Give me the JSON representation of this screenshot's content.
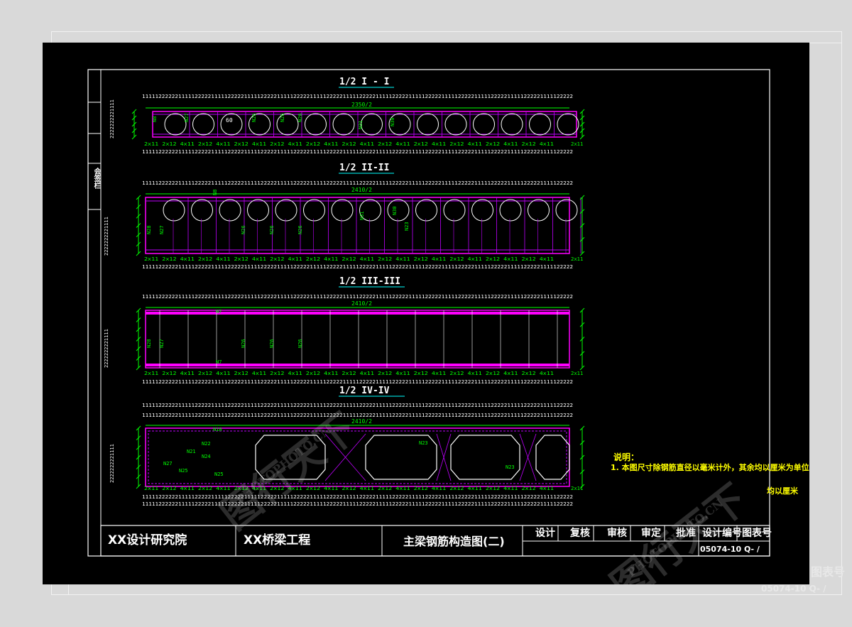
{
  "sections": [
    {
      "title": "1/2 I - I",
      "width_label": "2350/2",
      "rebar_labels": [
        "N8",
        "N27",
        "N26",
        "N26",
        "N26",
        "N31",
        "N30"
      ],
      "diameter_label": "60"
    },
    {
      "title": "1/2 II-II",
      "width_label": "2410/2",
      "rebar_labels": [
        "N8",
        "N28",
        "N27",
        "N26",
        "N26",
        "N26",
        "N31",
        "N30",
        "N23"
      ]
    },
    {
      "title": "1/2 III-III",
      "width_label": "2410/2",
      "rebar_labels": [
        "N7",
        "N7",
        "N28",
        "N27",
        "N26",
        "N26",
        "N26"
      ]
    },
    {
      "title": "1/2 IV-IV",
      "width_label": "2410/2",
      "rebar_labels": [
        "N10",
        "N21",
        "N22",
        "N24",
        "N25",
        "N27",
        "N23",
        "N23",
        "N25"
      ]
    }
  ],
  "spacing_rows": {
    "pattern_top": "2x11  2x12  4x11  2x12  4x11  2x12  4x11  2x12  4x11  2x12  4x11  2x12  4x11  2x12  4x11  2x12  4x11  2x12  4x11  2x12  4x11  2x12  4x11",
    "end_label": "2x11"
  },
  "side_stamp": "会签栏",
  "notes": {
    "heading": "说明：",
    "line1": "1. 本图尺寸除钢筋直径以毫米计外，其余均以厘米为单位。",
    "overflow_fragment": "均以厘米"
  },
  "title_block": {
    "institute": "XX设计研究院",
    "project": "XX桥梁工程",
    "drawing_title": "主梁钢筋构造图(二)",
    "roles": [
      "设计",
      "复核",
      "审核",
      "审定",
      "批准"
    ],
    "number_heading": "设计编号",
    "sheet_heading": "图表号",
    "drawing_number": "05074-10 Q-  /"
  },
  "background_fragments": {
    "sheet_heading": "图表号",
    "drawing_number": "05074-10 Q-  /"
  },
  "watermark": {
    "brand": "图行天下",
    "url": "PHOTOPHOTO.CN"
  },
  "colors": {
    "background": "#000000",
    "frame": "#ffffff",
    "dimension": "#00ff00",
    "structure": "#ff00ff",
    "stirrup": "#c000ff",
    "note": "#ffff00"
  }
}
